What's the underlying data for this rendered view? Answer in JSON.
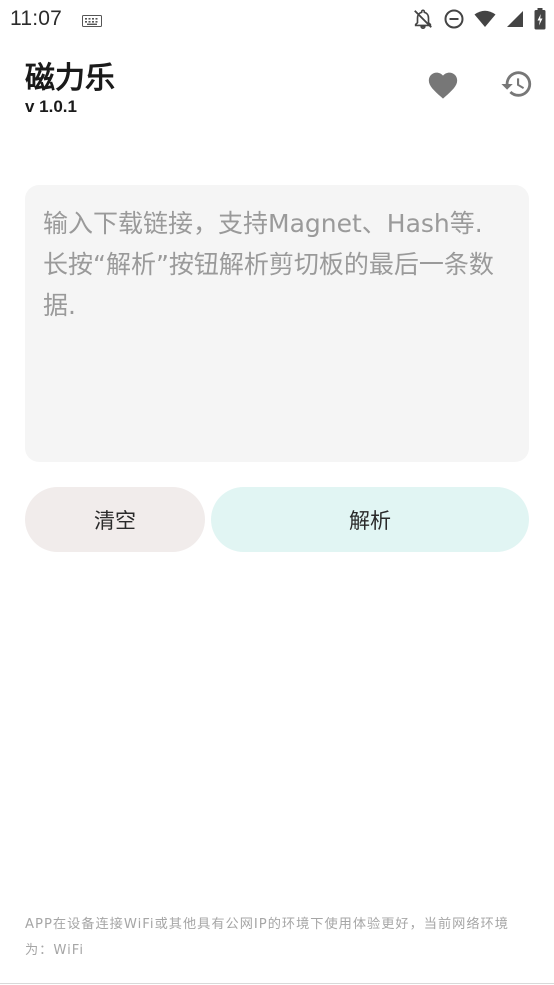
{
  "status_bar": {
    "time": "11:07",
    "icons": [
      "keyboard-icon",
      "notifications-off-icon",
      "do-not-disturb-icon",
      "wifi-icon",
      "cell-signal-icon",
      "battery-charging-icon"
    ]
  },
  "header": {
    "title": "磁力乐",
    "version": "v 1.0.1",
    "favorite_icon": "heart-icon",
    "history_icon": "history-icon"
  },
  "input": {
    "value": "",
    "placeholder": "输入下载链接，支持Magnet、Hash等.\n长按“解析”按钮解析剪切板的最后一条数据."
  },
  "actions": {
    "clear_label": "清空",
    "parse_label": "解析"
  },
  "footer": {
    "note": "APP在设备连接WiFi或其他具有公网IP的环境下使用体验更好，当前网络环境为：WiFi"
  },
  "colors": {
    "input_background": "#f5f5f5",
    "clear_button": "#f1eceb",
    "parse_button": "#e1f5f3",
    "icon_gray": "#777777",
    "footer_text": "#a6a6a6"
  }
}
